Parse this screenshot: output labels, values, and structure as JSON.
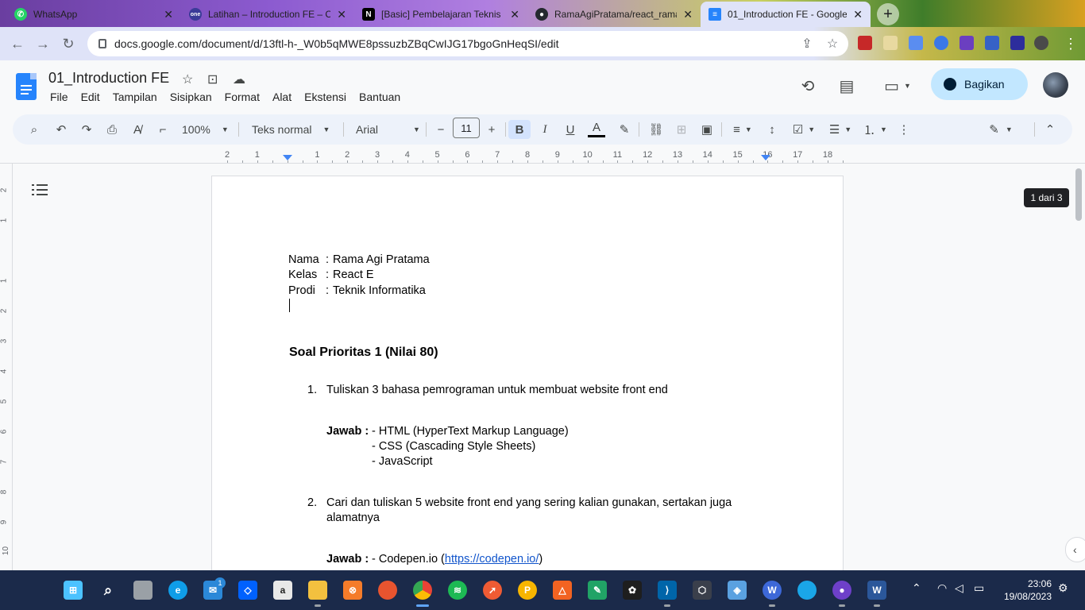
{
  "browser": {
    "tabs": [
      {
        "title": "WhatsApp",
        "icon": "whatsapp-icon",
        "color": "#25d366"
      },
      {
        "title": "Latihan – Introduction FE – C",
        "icon": "one-icon",
        "color": "#3b3b98"
      },
      {
        "title": "[Basic] Pembelajaran Teknis F",
        "icon": "notion-icon",
        "color": "#000000"
      },
      {
        "title": "RamaAgiPratama/react_rama",
        "icon": "github-icon",
        "color": "#24292f"
      },
      {
        "title": "01_Introduction FE - Google",
        "icon": "google-docs-icon",
        "color": "#2684fc"
      }
    ],
    "url": "docs.google.com/document/d/13ftl-h-_W0b5qMWE8pssuzbZBqCwIJG17bgoGnHeqSI/edit"
  },
  "docs": {
    "title": "01_Introduction FE",
    "menu": [
      "File",
      "Edit",
      "Tampilan",
      "Sisipkan",
      "Format",
      "Alat",
      "Ekstensi",
      "Bantuan"
    ],
    "share_label": "Bagikan",
    "toolbar": {
      "zoom": "100%",
      "style": "Teks normal",
      "font": "Arial",
      "font_size": "11"
    },
    "ruler_numbers": [
      "2",
      "1",
      "1",
      "2",
      "3",
      "4",
      "5",
      "6",
      "7",
      "8",
      "9",
      "10",
      "11",
      "12",
      "13",
      "14",
      "15",
      "16",
      "17",
      "18"
    ],
    "page_count": "1 dari 3",
    "accent": "#1a73e8"
  },
  "document": {
    "identity": [
      {
        "label": "Nama",
        "sep": ":",
        "value": "Rama Agi Pratama"
      },
      {
        "label": "Kelas",
        "sep": ":",
        "value": "React E"
      },
      {
        "label": "Prodi",
        "sep": ":",
        "value": "Teknik Informatika"
      }
    ],
    "heading": "Soal Prioritas 1 (Nilai 80)",
    "q1": {
      "number": "1.",
      "question": "Tuliskan 3 bahasa pemrograman untuk membuat website front end",
      "answer_label": "Jawab :",
      "answers": [
        "- HTML (HyperText Markup Language)",
        "- CSS (Cascading Style Sheets)",
        "- JavaScript"
      ]
    },
    "q2": {
      "number": "2.",
      "question_line1": "Cari dan tuliskan 5 website front end yang sering kalian gunakan, sertakan juga",
      "question_line2": "alamatnya",
      "answer_label": "Jawab :",
      "answer1_prefix": "- Codepen.io (",
      "answer1_link": "https://codepen.io/",
      "answer1_suffix": ")"
    }
  },
  "taskbar": {
    "time": "23:06",
    "date": "19/08/2023",
    "mail_badge": "1"
  }
}
